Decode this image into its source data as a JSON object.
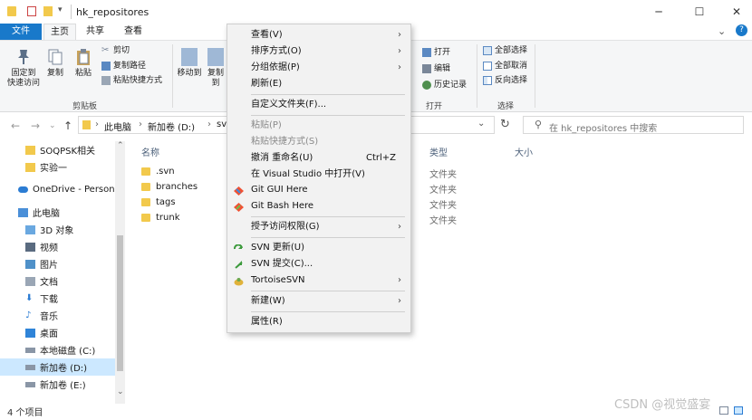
{
  "window": {
    "title": "hk_repositores",
    "minimize_glyph": "─",
    "maximize_glyph": "☐",
    "close_glyph": "✕",
    "qat_dropdown_glyph": "▾"
  },
  "tabs": [
    "文件",
    "主页",
    "共享",
    "查看"
  ],
  "ribbon": {
    "pin_label_1": "固定到",
    "pin_label_2": "快速访问",
    "copy_label": "复制",
    "paste_label": "粘贴",
    "cut_label": "剪切",
    "copy_path_label": "复制路径",
    "paste_shortcut_label": "粘贴快捷方式",
    "clipboard_group": "剪贴板",
    "move_to_label": "移动到",
    "copy_to_label": "复制到",
    "open_label": "打开",
    "edit_label": "编辑",
    "history_label": "历史记录",
    "open_group": "打开",
    "select_all_label": "全部选择",
    "select_none_label": "全部取消",
    "invert_selection_label": "反向选择",
    "select_group": "选择",
    "expand_ribbon_glyph": "⌄",
    "help_glyph": "?"
  },
  "nav": {
    "back_glyph": "←",
    "forward_glyph": "→",
    "recent_glyph": "⌄",
    "up_glyph": "↑",
    "breadcrumb": [
      "此电脑",
      "新加卷 (D:)",
      "svn"
    ],
    "breadcrumb_sep": "›",
    "address_dropdown_glyph": "⌄",
    "refresh_glyph": "↻",
    "search_icon_glyph": "⚲",
    "search_placeholder": "在 hk_repositores 中搜索"
  },
  "sidebar": {
    "items": [
      "SOQPSK相关",
      "实验一",
      "OneDrive - Personal",
      "此电脑",
      "3D 对象",
      "视频",
      "图片",
      "文档",
      "下载",
      "音乐",
      "桌面",
      "本地磁盘 (C:)",
      "新加卷 (D:)",
      "新加卷 (E:)"
    ],
    "scroll_up_glyph": "⌃",
    "scroll_down_glyph": "⌄"
  },
  "filelist": {
    "columns": [
      "名称",
      "类型",
      "大小"
    ],
    "rows": [
      {
        "name": ".svn",
        "type": "文件夹"
      },
      {
        "name": "branches",
        "type": "文件夹"
      },
      {
        "name": "tags",
        "type": "文件夹"
      },
      {
        "name": "trunk",
        "type": "文件夹"
      }
    ]
  },
  "status": {
    "count": "4 个项目"
  },
  "watermark": "CSDN @视觉盛宴",
  "context_menu": {
    "items": [
      {
        "label": "查看(V)",
        "submenu": true
      },
      {
        "label": "排序方式(O)",
        "submenu": true
      },
      {
        "label": "分组依据(P)",
        "submenu": true
      },
      {
        "label": "刷新(E)"
      },
      {
        "label": "自定义文件夹(F)..."
      },
      {
        "label": "粘贴(P)",
        "disabled": true
      },
      {
        "label": "粘贴快捷方式(S)",
        "disabled": true
      },
      {
        "label": "撤消 重命名(U)",
        "shortcut": "Ctrl+Z"
      },
      {
        "label": "在 Visual Studio 中打开(V)"
      },
      {
        "label": "Git GUI Here"
      },
      {
        "label": "Git Bash Here"
      },
      {
        "label": "授予访问权限(G)",
        "submenu": true
      },
      {
        "label": "SVN 更新(U)"
      },
      {
        "label": "SVN 提交(C)..."
      },
      {
        "label": "TortoiseSVN",
        "submenu": true
      },
      {
        "label": "新建(W)",
        "submenu": true
      },
      {
        "label": "属性(R)"
      }
    ],
    "submenu_glyph": "›"
  },
  "colors": {
    "accent": "#1979ca",
    "folder": "#f2c94c",
    "selected_row": "#cce8ff"
  }
}
